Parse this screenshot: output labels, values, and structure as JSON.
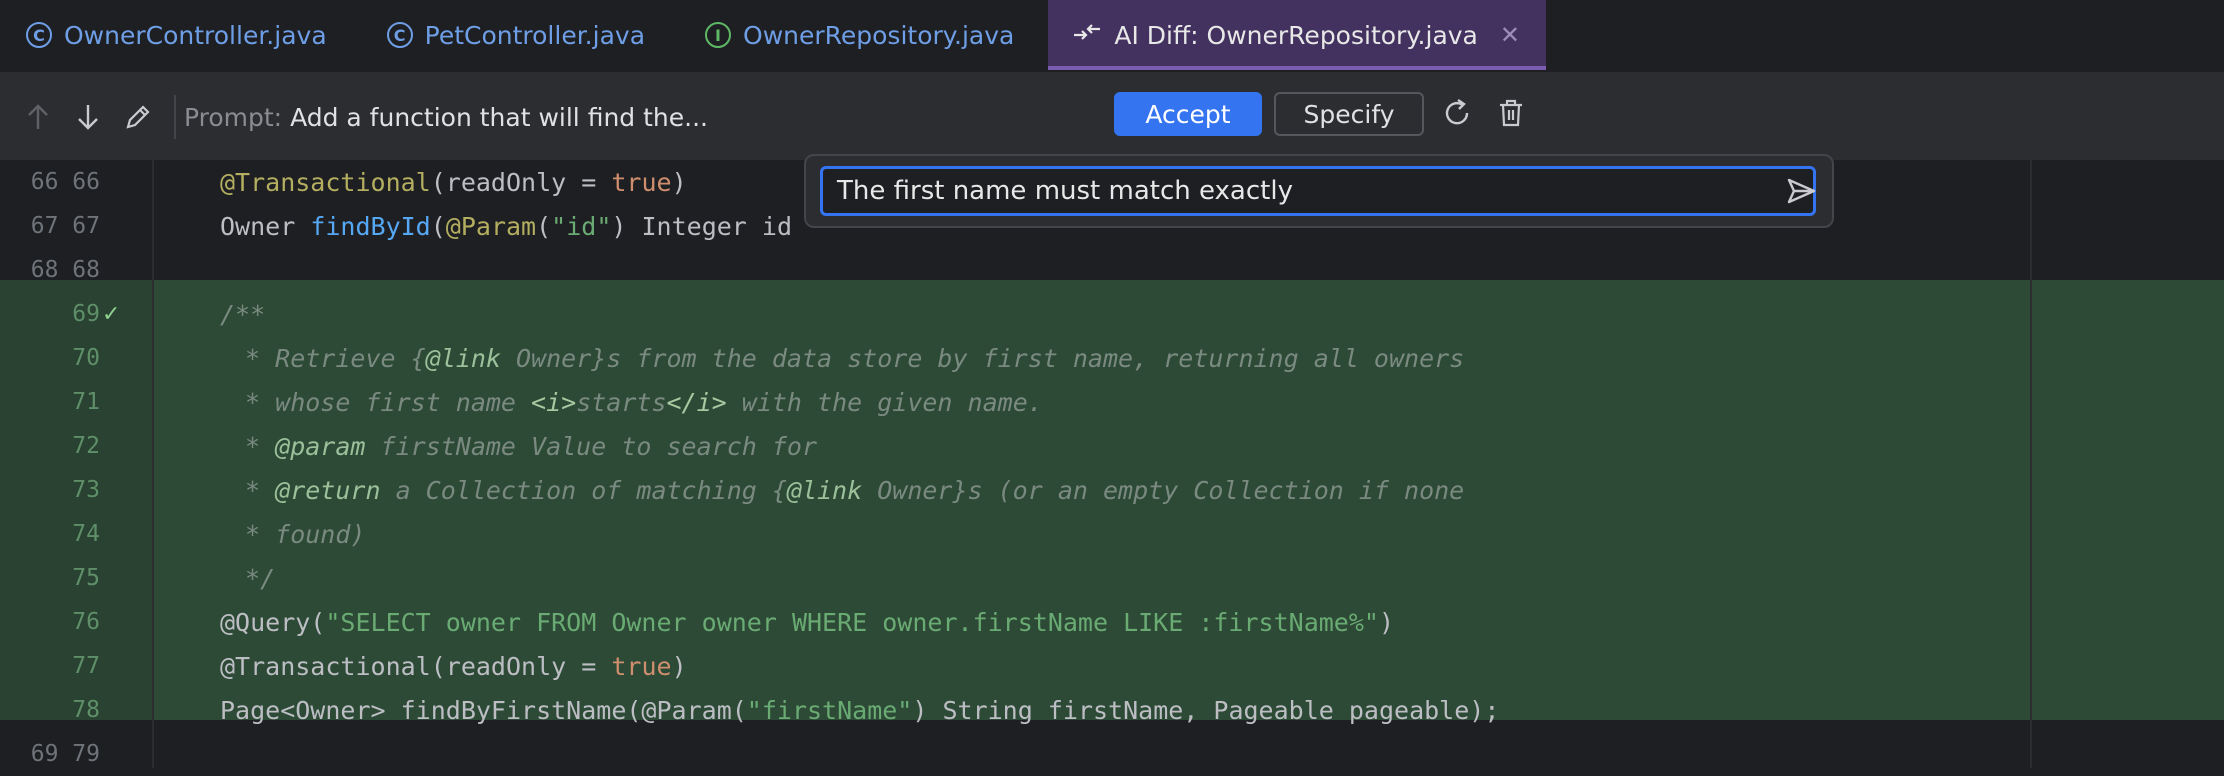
{
  "tabs": [
    {
      "label": "OwnerController.java",
      "icon": "C"
    },
    {
      "label": "PetController.java",
      "icon": "C"
    },
    {
      "label": "OwnerRepository.java",
      "icon": "I"
    },
    {
      "label": "AI Diff: OwnerRepository.java"
    }
  ],
  "toolbar": {
    "prompt_label": "Prompt:",
    "prompt_text": "Add a function that will find the...",
    "accept_label": "Accept",
    "specify_label": "Specify"
  },
  "popup": {
    "input_value": "The first name must match exactly"
  },
  "lines": [
    {
      "old": "66",
      "new": "66",
      "parts": [
        [
          "ann",
          "@Transactional"
        ],
        [
          "",
          "(readOnly = "
        ],
        [
          "kw",
          "true"
        ],
        [
          "",
          ")"
        ]
      ]
    },
    {
      "old": "67",
      "new": "67",
      "parts": [
        [
          "",
          "Owner "
        ],
        [
          "fn",
          "findById"
        ],
        [
          "",
          "("
        ],
        [
          "ann",
          "@Param"
        ],
        [
          "",
          "("
        ],
        [
          "str",
          "\"id\""
        ],
        [
          "",
          ") Integer id"
        ]
      ]
    },
    {
      "old": "68",
      "new": "68",
      "parts": []
    },
    {
      "old": "",
      "new": "69",
      "parts": [
        [
          "cmt",
          "/**"
        ]
      ]
    },
    {
      "old": "",
      "new": "70",
      "parts": [
        [
          "cmt",
          " * Retrieve {"
        ],
        [
          "doctag",
          "@link"
        ],
        [
          "cmt",
          " Owner}s from the data store by first name, returning all owners"
        ]
      ]
    },
    {
      "old": "",
      "new": "71",
      "parts": [
        [
          "cmt",
          " * whose first name "
        ],
        [
          "tag",
          "<i>"
        ],
        [
          "cmt",
          "starts"
        ],
        [
          "tag",
          "</i>"
        ],
        [
          "cmt",
          " with the given name."
        ]
      ]
    },
    {
      "old": "",
      "new": "72",
      "parts": [
        [
          "cmt",
          " * "
        ],
        [
          "doctag",
          "@param"
        ],
        [
          "cmt",
          " firstName Value to search for"
        ]
      ]
    },
    {
      "old": "",
      "new": "73",
      "parts": [
        [
          "cmt",
          " * "
        ],
        [
          "doctag",
          "@return"
        ],
        [
          "cmt",
          " a Collection of matching {"
        ],
        [
          "doctag",
          "@link"
        ],
        [
          "cmt",
          " Owner}s (or an empty Collection if none"
        ]
      ]
    },
    {
      "old": "",
      "new": "74",
      "parts": [
        [
          "cmt",
          " * found)"
        ]
      ]
    },
    {
      "old": "",
      "new": "75",
      "parts": [
        [
          "cmt",
          " */"
        ]
      ]
    },
    {
      "old": "",
      "new": "76",
      "parts": [
        [
          "",
          "@Query("
        ],
        [
          "str",
          "\"SELECT owner FROM Owner owner WHERE owner.firstName LIKE :firstName%\""
        ],
        [
          "",
          ")"
        ]
      ]
    },
    {
      "old": "",
      "new": "77",
      "parts": [
        [
          "",
          "@Transactional(readOnly = "
        ],
        [
          "kw",
          "true"
        ],
        [
          "",
          ")"
        ]
      ]
    },
    {
      "old": "",
      "new": "78",
      "parts": [
        [
          "",
          "Page<Owner> findByFirstName(@Param("
        ],
        [
          "str",
          "\"firstName\""
        ],
        [
          "",
          ") String firstName, Pageable pageable);"
        ]
      ]
    },
    {
      "old": "69",
      "new": "79",
      "parts": []
    }
  ]
}
